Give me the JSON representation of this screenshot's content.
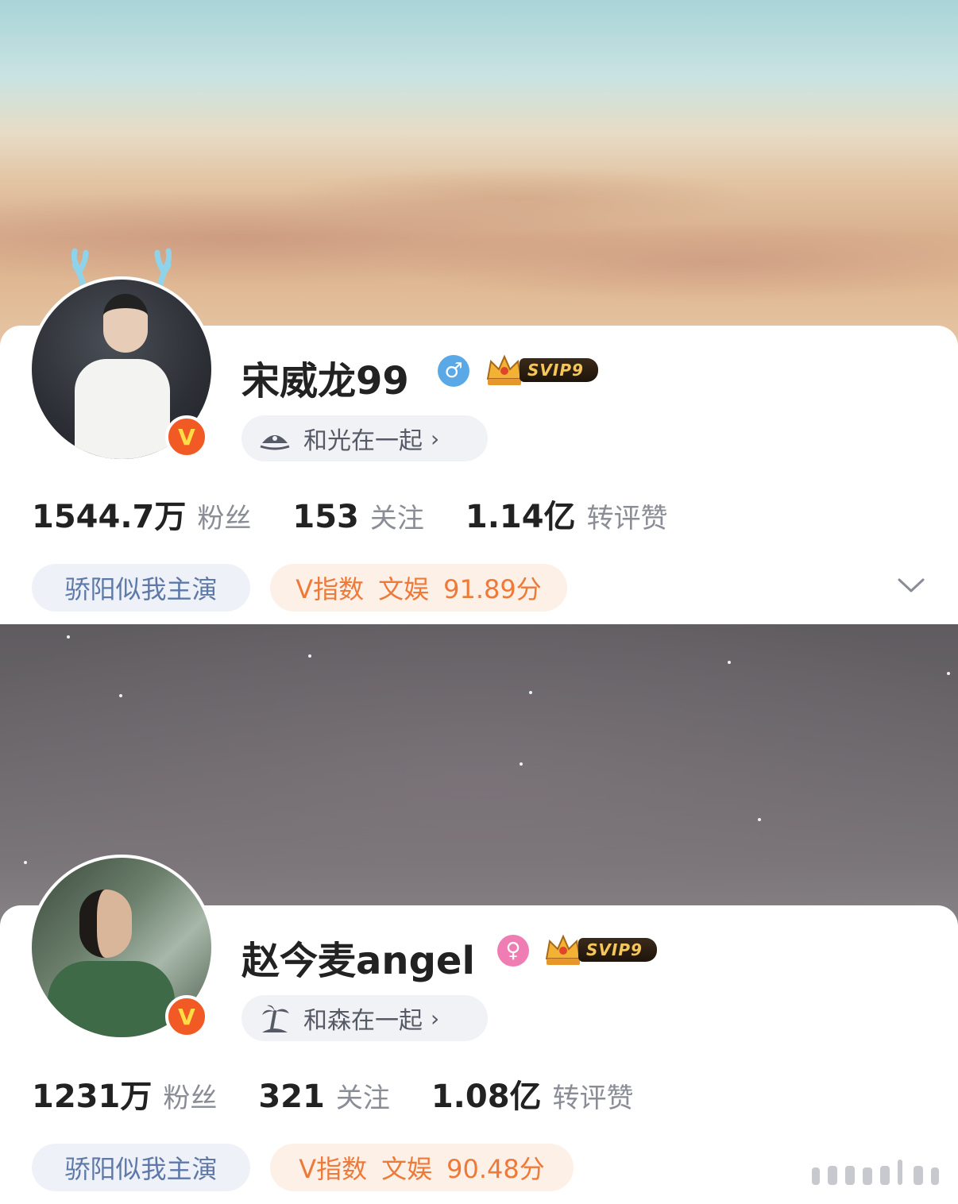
{
  "profiles": [
    {
      "name": "宋威龙99",
      "gender_icon": "male-symbol",
      "gender_glyph": "♂",
      "svip_label": "SVIP9",
      "together_label": "和光在一起",
      "together_arrow": "›",
      "together_icon": "beach-umbrella-icon",
      "stats": [
        {
          "value": "1544.7万",
          "label": "粉丝"
        },
        {
          "value": "153",
          "label": "关注"
        },
        {
          "value": "1.14亿",
          "label": "转评赞"
        }
      ],
      "tag": "骄阳似我主演",
      "v_index": {
        "label": "V指数",
        "category": "文娱",
        "score": "91.89分"
      },
      "verified_badge": "V"
    },
    {
      "name": "赵今麦angel",
      "gender_icon": "female-symbol",
      "gender_glyph": "♀",
      "svip_label": "SVIP9",
      "together_label": "和森在一起",
      "together_arrow": "›",
      "together_icon": "palm-tree-icon",
      "stats": [
        {
          "value": "1231万",
          "label": "粉丝"
        },
        {
          "value": "321",
          "label": "关注"
        },
        {
          "value": "1.08亿",
          "label": "转评赞"
        }
      ],
      "tag": "骄阳似我主演",
      "v_index": {
        "label": "V指数",
        "category": "文娱",
        "score": "90.48分"
      },
      "verified_badge": "V"
    }
  ],
  "colors": {
    "male": "#5aa9e6",
    "female": "#f07cb4",
    "v_badge": "#f15a24",
    "tag_blue": "#5e79a8",
    "tag_orange": "#ee7a3a"
  }
}
